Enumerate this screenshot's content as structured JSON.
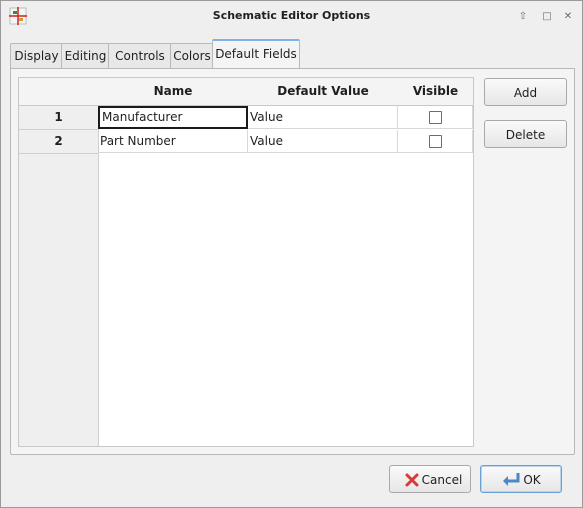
{
  "window": {
    "title": "Schematic Editor Options",
    "icons": [
      "app-icon",
      "minimize-icon",
      "maximize-icon",
      "close-icon"
    ]
  },
  "tabs": [
    {
      "label": "Display",
      "active": false
    },
    {
      "label": "Editing",
      "active": false
    },
    {
      "label": "Controls",
      "active": false
    },
    {
      "label": "Colors",
      "active": false
    },
    {
      "label": "Default Fields",
      "active": true
    }
  ],
  "grid": {
    "columns": [
      "Name",
      "Default Value",
      "Visible"
    ],
    "rows": [
      {
        "num": "1",
        "name": "Manufacturer",
        "value": "Value",
        "visible": false
      },
      {
        "num": "2",
        "name": "Part Number",
        "value": "Value",
        "visible": false
      }
    ]
  },
  "side_buttons": {
    "add_label": "Add",
    "delete_label": "Delete"
  },
  "footer": {
    "cancel_label": "Cancel",
    "ok_label": "OK"
  },
  "colors": {
    "accent": "#7fb3e6",
    "cancel_icon": "#d73a3a",
    "ok_icon": "#4a86c8"
  }
}
